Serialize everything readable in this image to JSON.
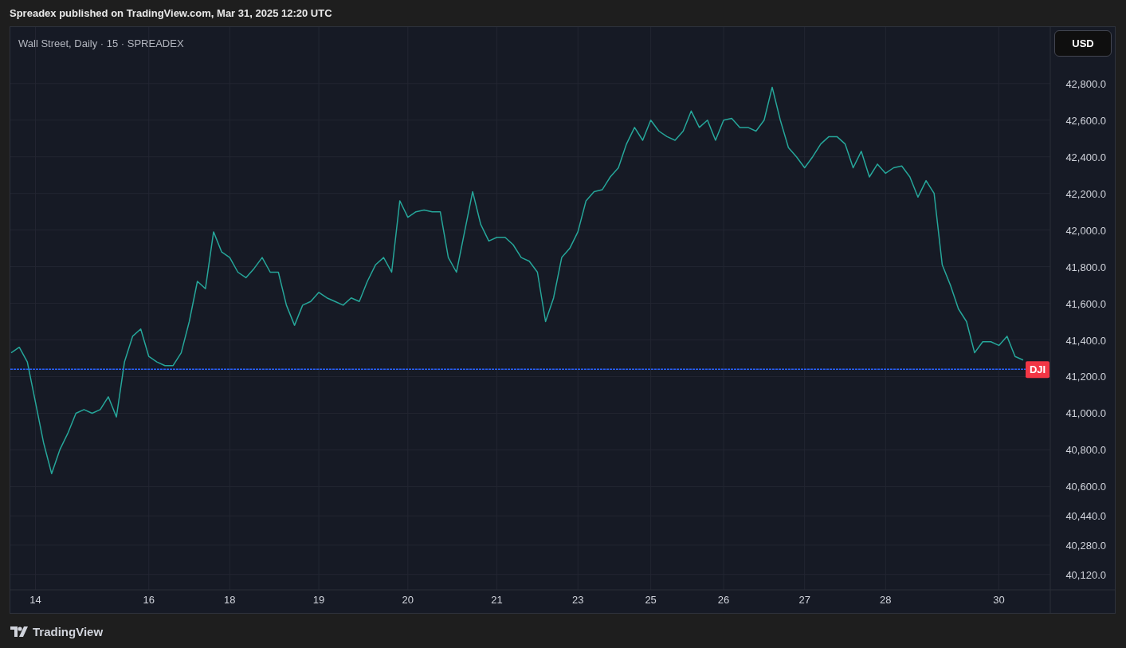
{
  "header": {
    "text": "Spreadex published on TradingView.com, Mar 31, 2025 12:20 UTC"
  },
  "chart": {
    "legend": "Wall Street, Daily · 15 · SPREADEX",
    "currency_button": "USD",
    "chart_data": {
      "type": "line",
      "ylim": [
        40036,
        43108
      ],
      "categories": [
        null,
        null,
        null,
        "14",
        null,
        null,
        null,
        null,
        null,
        null,
        null,
        null,
        null,
        null,
        null,
        null,
        null,
        "16",
        null,
        null,
        null,
        null,
        null,
        null,
        null,
        null,
        null,
        "18",
        null,
        null,
        null,
        null,
        null,
        null,
        null,
        null,
        null,
        null,
        "19",
        null,
        null,
        null,
        null,
        null,
        null,
        null,
        null,
        null,
        null,
        "20",
        null,
        null,
        null,
        null,
        null,
        null,
        null,
        null,
        null,
        null,
        "21",
        null,
        null,
        null,
        null,
        null,
        null,
        null,
        null,
        null,
        "23",
        null,
        null,
        null,
        null,
        null,
        null,
        null,
        null,
        "25",
        null,
        null,
        null,
        null,
        null,
        null,
        null,
        null,
        "26",
        null,
        null,
        null,
        null,
        null,
        null,
        null,
        null,
        null,
        "27",
        null,
        null,
        null,
        null,
        null,
        null,
        null,
        null,
        null,
        "28",
        null,
        null,
        null,
        null,
        null,
        null,
        null,
        null,
        null,
        null,
        null,
        null,
        null,
        "30",
        null,
        null,
        null
      ],
      "yticks": [
        {
          "value": 42800,
          "label": "42,800.0"
        },
        {
          "value": 42600,
          "label": "42,600.0"
        },
        {
          "value": 42400,
          "label": "42,400.0"
        },
        {
          "value": 42200,
          "label": "42,200.0"
        },
        {
          "value": 42000,
          "label": "42,000.0"
        },
        {
          "value": 41800,
          "label": "41,800.0"
        },
        {
          "value": 41600,
          "label": "41,600.0"
        },
        {
          "value": 41400,
          "label": "41,400.0"
        },
        {
          "value": 41200,
          "label": "41,200.0"
        },
        {
          "value": 41000,
          "label": "41,000.0"
        },
        {
          "value": 40800,
          "label": "40,800.0"
        },
        {
          "value": 40600,
          "label": "40,600.0"
        },
        {
          "value": 40440,
          "label": "40,440.0"
        },
        {
          "value": 40280,
          "label": "40,280.0"
        },
        {
          "value": 40120,
          "label": "40,120.0"
        }
      ],
      "series": [
        {
          "color": "#26a69a",
          "values": [
            41330,
            41360,
            41280,
            41060,
            40840,
            40670,
            40800,
            40890,
            41000,
            41020,
            41000,
            41020,
            41090,
            40980,
            41280,
            41420,
            41460,
            41310,
            41280,
            41260,
            41260,
            41330,
            41500,
            41720,
            41680,
            41990,
            41880,
            41850,
            41770,
            41740,
            41790,
            41850,
            41770,
            41770,
            41590,
            41480,
            41590,
            41610,
            41660,
            41630,
            41610,
            41590,
            41630,
            41610,
            41720,
            41810,
            41850,
            41770,
            42160,
            42070,
            42100,
            42110,
            42100,
            42100,
            41850,
            41770,
            41990,
            42210,
            42030,
            41940,
            41960,
            41960,
            41920,
            41850,
            41830,
            41770,
            41500,
            41630,
            41850,
            41900,
            41990,
            42160,
            42210,
            42220,
            42290,
            42340,
            42470,
            42560,
            42490,
            42600,
            42540,
            42510,
            42490,
            42540,
            42650,
            42560,
            42600,
            42490,
            42600,
            42610,
            42560,
            42560,
            42540,
            42600,
            42780,
            42600,
            42450,
            42400,
            42340,
            42400,
            42470,
            42510,
            42510,
            42470,
            42340,
            42430,
            42290,
            42360,
            42310,
            42340,
            42350,
            42290,
            42180,
            42270,
            42200,
            41810,
            41700,
            41570,
            41500,
            41330,
            41390,
            41390,
            41370,
            41420,
            41310,
            41290
          ]
        }
      ],
      "grid": true,
      "ref_lines": [
        {
          "axis": "y",
          "value": 41240,
          "label": "DJI",
          "color": "#2962ff"
        }
      ]
    }
  },
  "footer": {
    "brand": "TradingView"
  }
}
